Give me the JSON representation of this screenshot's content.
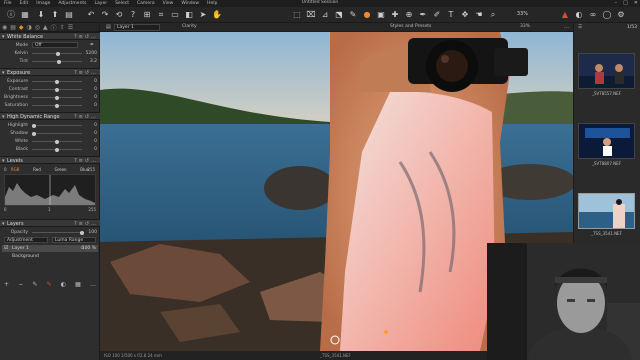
{
  "app": {
    "title": "Untitled Session"
  },
  "menu": {
    "items": [
      "File",
      "Edit",
      "Image",
      "Adjustments",
      "Layer",
      "Select",
      "Camera",
      "View",
      "Window",
      "Help"
    ]
  },
  "toolbar": {
    "zoom": "33%"
  },
  "viewer": {
    "layer_name": "Layer 1",
    "tool_name": "Clarity",
    "styles_label": "Styles and Presets",
    "filename": "_TSS_3541.NEF",
    "status_text": "ISO 100   1/500 s   f/2.8   24 mm"
  },
  "panel": {
    "white_balance": {
      "title": "White Balance",
      "mode_label": "Mode",
      "mode_value": "Off",
      "kelvin_label": "Kelvin",
      "kelvin_value": "5200",
      "tint_label": "Tint",
      "tint_value": "3.2"
    },
    "exposure": {
      "title": "Exposure",
      "rows": [
        {
          "label": "Exposure",
          "value": "0"
        },
        {
          "label": "Contrast",
          "value": "0"
        },
        {
          "label": "Brightness",
          "value": "0"
        },
        {
          "label": "Saturation",
          "value": "0"
        }
      ]
    },
    "hdr": {
      "title": "High Dynamic Range",
      "rows": [
        {
          "label": "Highlight",
          "value": "0"
        },
        {
          "label": "Shadow",
          "value": "0"
        },
        {
          "label": "White",
          "value": "0"
        },
        {
          "label": "Black",
          "value": "0"
        }
      ]
    },
    "levels": {
      "title": "Levels",
      "tabs": [
        "RGB",
        "Red",
        "Green",
        "Blue"
      ],
      "input_min": "0",
      "input_max": "255",
      "output_min": "0",
      "output_max": "255",
      "mid": "1"
    },
    "layers": {
      "title": "Layers",
      "opacity_label": "Opacity",
      "opacity_value": "100",
      "adjustment_label": "Adjustment",
      "mask_label": "Luma Range",
      "items": [
        {
          "name": "Layer 1",
          "opacity": "100 %"
        },
        {
          "name": "Background"
        }
      ]
    }
  },
  "filmstrip": {
    "count": "1/53",
    "items": [
      {
        "name": "_SVT8557.NEF"
      },
      {
        "name": "_SVT8807.NEF"
      },
      {
        "name": "_TSS_3541.NEF"
      }
    ]
  },
  "colors": {
    "accent": "#ee8a2c",
    "panel_bg": "#2e2e2e",
    "toolbar_bg": "#262626"
  }
}
